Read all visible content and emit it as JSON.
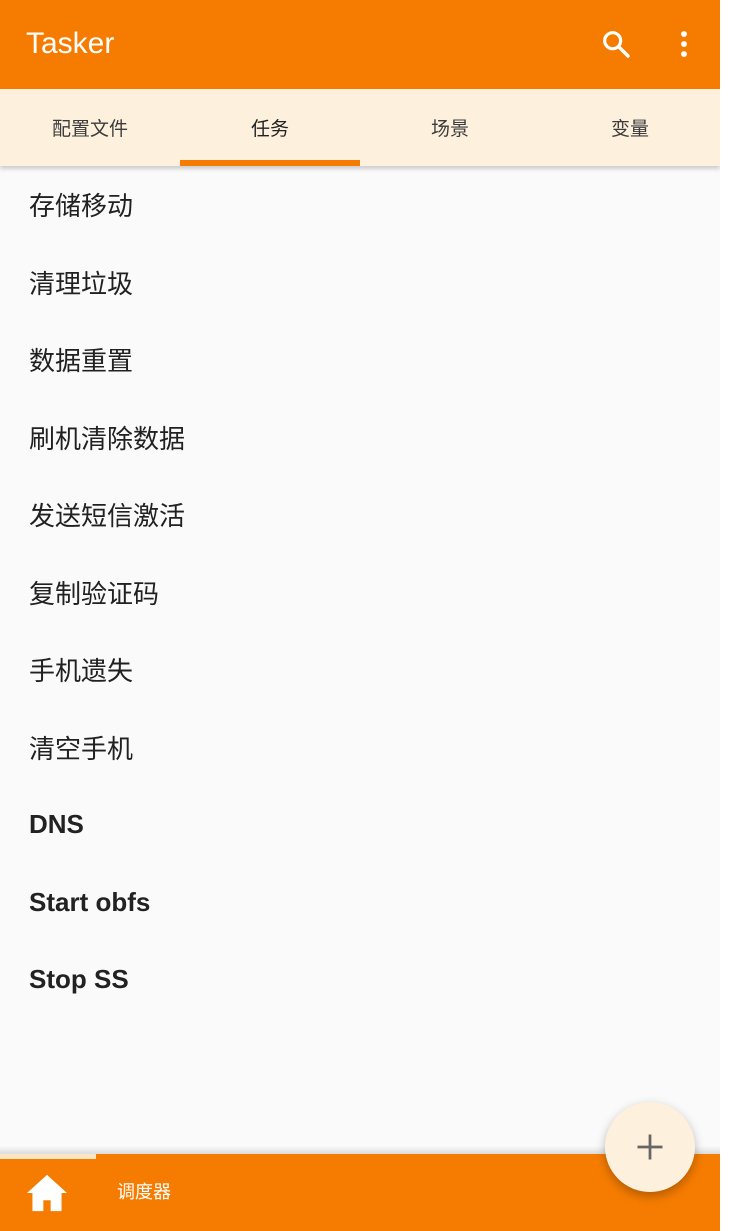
{
  "app": {
    "title": "Tasker"
  },
  "appbar": {
    "search_icon": "search-icon",
    "more_icon": "more-vert-icon"
  },
  "tabs": [
    {
      "label": "配置文件",
      "active": false
    },
    {
      "label": "任务",
      "active": true
    },
    {
      "label": "场景",
      "active": false
    },
    {
      "label": "变量",
      "active": false
    }
  ],
  "tasks": [
    {
      "label": "存储移动"
    },
    {
      "label": "清理垃圾"
    },
    {
      "label": "数据重置"
    },
    {
      "label": "刷机清除数据"
    },
    {
      "label": "发送短信激活"
    },
    {
      "label": "复制验证码"
    },
    {
      "label": "手机遗失"
    },
    {
      "label": "清空手机"
    },
    {
      "label": "DNS"
    },
    {
      "label": "Start obfs"
    },
    {
      "label": "Stop SS"
    }
  ],
  "bottom_bar": {
    "home_icon": "home-icon",
    "label": "调度器"
  },
  "fab": {
    "icon": "plus-icon"
  },
  "colors": {
    "primary": "#f57c00",
    "tab_background": "#fdf0dc",
    "list_background": "#fafafa",
    "text": "#212121"
  }
}
